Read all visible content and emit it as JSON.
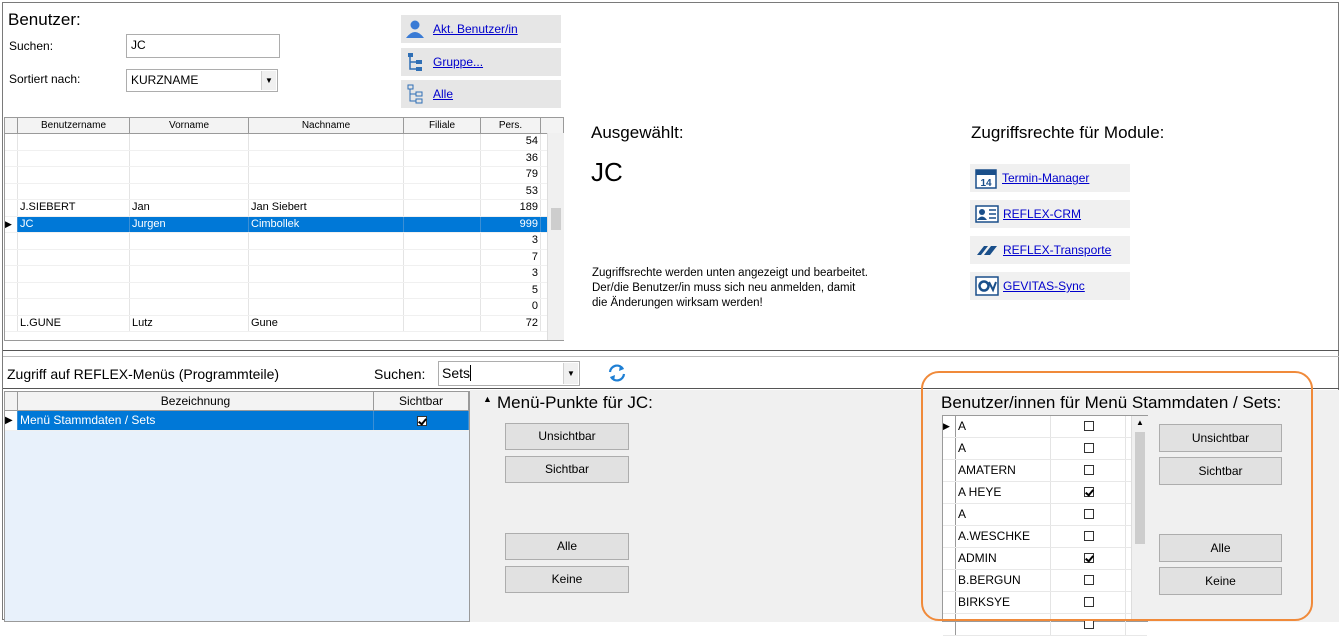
{
  "users": {
    "heading": "Benutzer:",
    "search_label": "Suchen:",
    "search_value": "JC",
    "sort_label": "Sortiert nach:",
    "sort_value": "KURZNAME",
    "btn_current": "Akt. Benutzer/in",
    "btn_group": "Gruppe...",
    "btn_all": "Alle",
    "columns": [
      "Benutzername",
      "Vorname",
      "Nachname",
      "Filiale",
      "Pers."
    ],
    "rows": [
      {
        "user": "",
        "first": "",
        "last": "",
        "branch": "",
        "pers": "54"
      },
      {
        "user": "",
        "first": "",
        "last": "",
        "branch": "",
        "pers": "36"
      },
      {
        "user": "",
        "first": "",
        "last": "",
        "branch": "",
        "pers": "79"
      },
      {
        "user": "",
        "first": "",
        "last": "",
        "branch": "",
        "pers": "53"
      },
      {
        "user": "J.SIEBERT",
        "first": "Jan",
        "last": "Jan Siebert",
        "branch": "",
        "pers": "189"
      },
      {
        "user": "JC",
        "first": "Jurgen",
        "last": "Cimbollek",
        "branch": "",
        "pers": "999"
      },
      {
        "user": "",
        "first": "",
        "last": "",
        "branch": "",
        "pers": "3"
      },
      {
        "user": "",
        "first": "",
        "last": "",
        "branch": "",
        "pers": "7"
      },
      {
        "user": "",
        "first": "",
        "last": "",
        "branch": "",
        "pers": "3"
      },
      {
        "user": "",
        "first": "",
        "last": "",
        "branch": "",
        "pers": "5"
      },
      {
        "user": "",
        "first": "",
        "last": "",
        "branch": "",
        "pers": "0"
      },
      {
        "user": "L.GUNE",
        "first": "Lutz",
        "last": "Gune",
        "branch": "",
        "pers": "72"
      }
    ]
  },
  "selected": {
    "heading": "Ausgewählt:",
    "value": "JC",
    "info_line1": "Zugriffsrechte werden unten angezeigt und bearbeitet.",
    "info_line2": "Der/die Benutzer/in muss sich neu  anmelden, damit",
    "info_line3": "die Änderungen wirksam werden!"
  },
  "modules": {
    "heading": "Zugriffsrechte für Module:",
    "items": [
      {
        "label": "Termin-Manager",
        "icon": "calendar-icon"
      },
      {
        "label": "REFLEX-CRM",
        "icon": "contact-card-icon"
      },
      {
        "label": "REFLEX-Transporte",
        "icon": "transport-icon"
      },
      {
        "label": "GEVITAS-Sync",
        "icon": "sync-icon"
      }
    ]
  },
  "menus": {
    "heading": "Zugriff auf REFLEX-Menüs (Programmteile)",
    "search_label": "Suchen:",
    "search_value": "Sets",
    "columns": [
      "Bezeichnung",
      "Sichtbar"
    ],
    "rows": [
      {
        "name": "Menü Stammdaten / Sets",
        "visible": true
      }
    ]
  },
  "menu_points": {
    "heading": "Menü-Punkte für JC:",
    "btn_invisible": "Unsichtbar",
    "btn_visible": "Sichtbar",
    "btn_all": "Alle",
    "btn_none": "Keine"
  },
  "menu_users": {
    "heading": "Benutzer/innen für Menü Stammdaten / Sets:",
    "btn_invisible": "Unsichtbar",
    "btn_visible": "Sichtbar",
    "btn_all": "Alle",
    "btn_none": "Keine",
    "rows": [
      {
        "name": "A",
        "checked": false
      },
      {
        "name": "A",
        "checked": false
      },
      {
        "name": "AMATERN",
        "checked": false
      },
      {
        "name": "A HEYE",
        "checked": true
      },
      {
        "name": "A",
        "checked": false
      },
      {
        "name": "A.WESCHKE",
        "checked": false
      },
      {
        "name": "ADMIN",
        "checked": true
      },
      {
        "name": "B.BERGUN",
        "checked": false
      },
      {
        "name": "BIRKSYE",
        "checked": false
      },
      {
        "name": "",
        "checked": false
      }
    ]
  },
  "colors": {
    "selection": "#0078d7",
    "highlight_border": "#f08a3a",
    "link": "#0000cc",
    "sync": "#1e7fd4"
  }
}
